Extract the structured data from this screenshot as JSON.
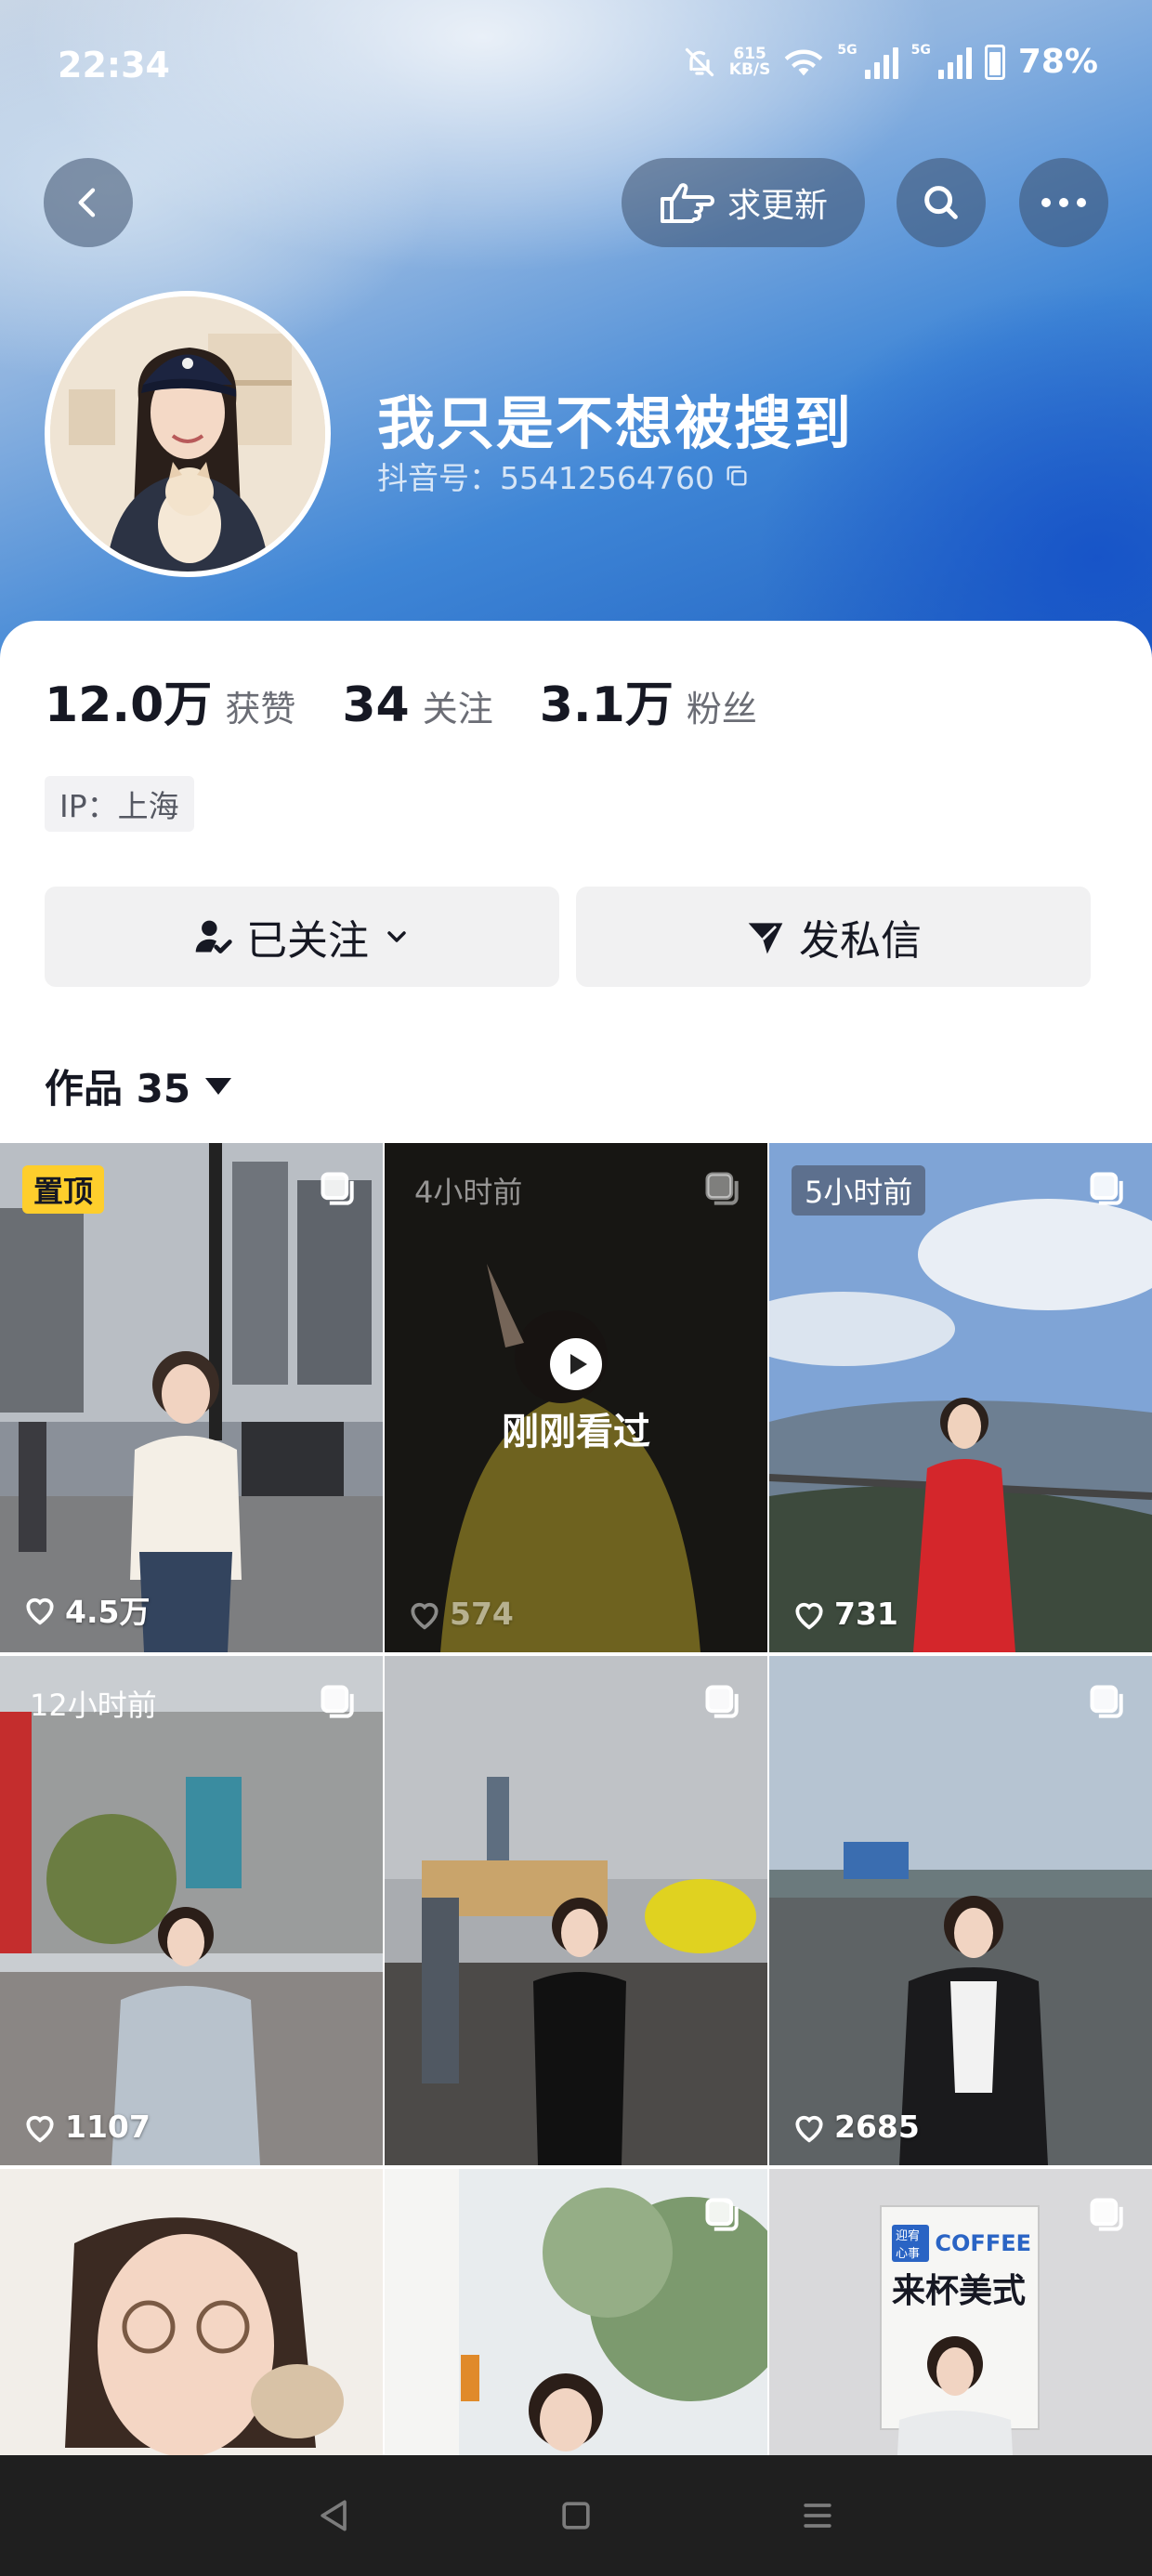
{
  "status_bar": {
    "time": "22:34",
    "net_speed_value": "615",
    "net_speed_unit": "KB/S",
    "signal1_label": "5G",
    "signal2_label": "5G",
    "battery": "78%"
  },
  "header": {
    "update_button_label": "求更新",
    "icons": [
      "back-arrow-icon",
      "pointing-hand-icon",
      "search-icon",
      "more-icon"
    ]
  },
  "profile": {
    "name": "我只是不想被搜到",
    "id_text": "抖音号：55412564760",
    "stats": [
      {
        "value": "12.0万",
        "label": "获赞"
      },
      {
        "value": "34",
        "label": "关注"
      },
      {
        "value": "3.1万",
        "label": "粉丝"
      }
    ],
    "ip": "IP：上海",
    "follow_button": "已关注",
    "message_button": "发私信"
  },
  "works": {
    "header": "作品 35",
    "tiles": [
      {
        "badge": "置顶",
        "likes": "4.5万"
      },
      {
        "time": "4小时前",
        "likes": "574",
        "overlay": "刚刚看过"
      },
      {
        "time": "5小时前",
        "likes": "731"
      },
      {
        "time": "12小时前",
        "likes": "1107"
      },
      {
        "time": "",
        "likes": ""
      },
      {
        "time": "",
        "likes": "2685"
      },
      {
        "time": "",
        "likes": ""
      },
      {
        "time": "",
        "likes": ""
      },
      {
        "time": "",
        "likes": "",
        "poster_tag": "迎宥心事",
        "poster_word": "COFFEE",
        "poster_title": "来杯美式"
      }
    ]
  },
  "colors": {
    "pin_badge": "#fece2c",
    "button_bg": "#f1f1f2",
    "nav_bar": "#1f1f1f"
  }
}
